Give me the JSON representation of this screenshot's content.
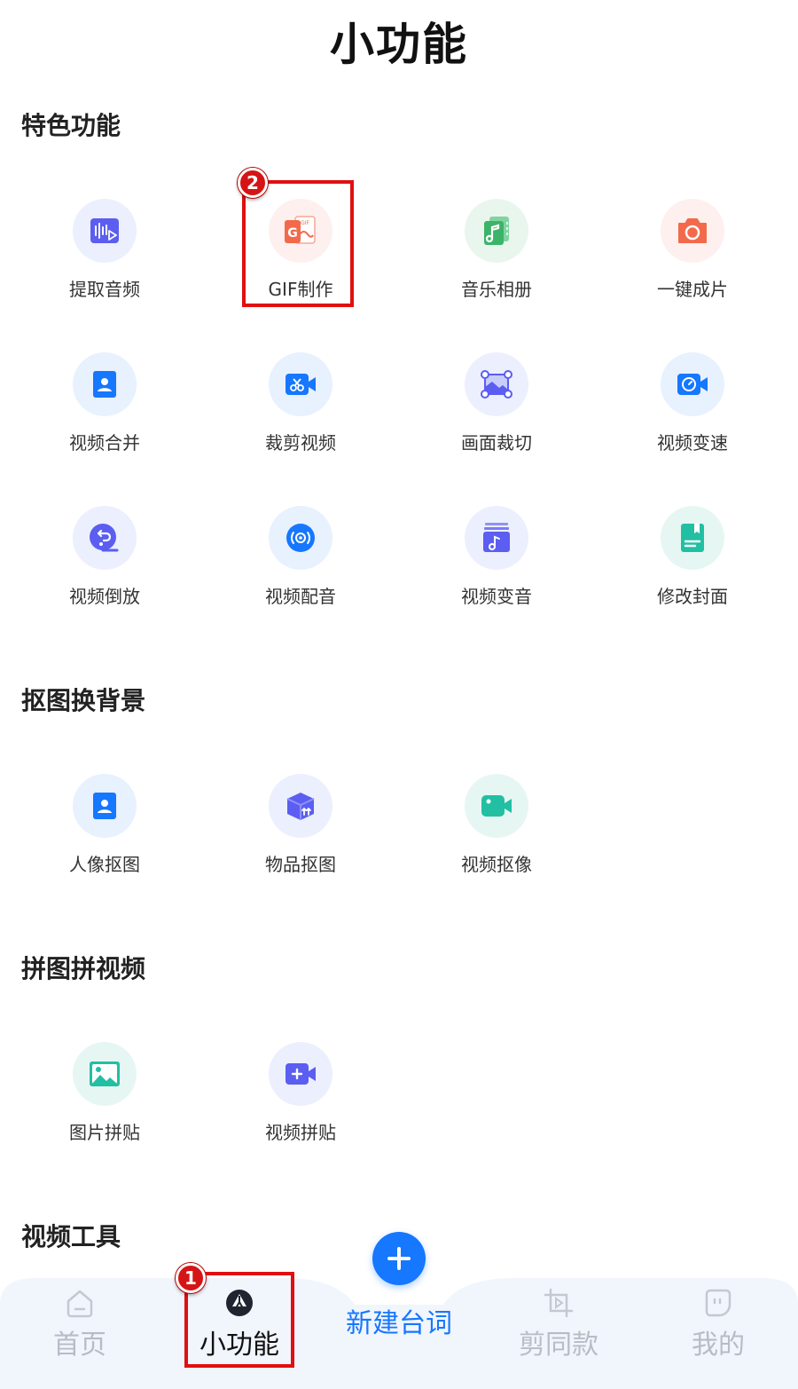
{
  "header": {
    "title": "小功能"
  },
  "sections": {
    "featured": {
      "title": "特色功能",
      "items": [
        {
          "label": "提取音频",
          "icon": "audio-extract-icon",
          "color": "#5b5ef0",
          "bg": "#eceffd"
        },
        {
          "label": "GIF制作",
          "icon": "gif-icon",
          "color": "#f26a4b",
          "bg": "#fdf0ee"
        },
        {
          "label": "音乐相册",
          "icon": "music-album-icon",
          "color": "#3db36a",
          "bg": "#e9f6ee"
        },
        {
          "label": "一键成片",
          "icon": "camera-icon",
          "color": "#f26a4b",
          "bg": "#fdf0ee"
        },
        {
          "label": "视频合并",
          "icon": "video-merge-icon",
          "color": "#1677ff",
          "bg": "#e8f1fe"
        },
        {
          "label": "裁剪视频",
          "icon": "video-trim-icon",
          "color": "#1677ff",
          "bg": "#e8f1fe"
        },
        {
          "label": "画面裁切",
          "icon": "crop-icon",
          "color": "#5b5ef0",
          "bg": "#eceffd"
        },
        {
          "label": "视频变速",
          "icon": "speed-icon",
          "color": "#1677ff",
          "bg": "#e8f1fe"
        },
        {
          "label": "视频倒放",
          "icon": "reverse-icon",
          "color": "#5b5ef0",
          "bg": "#eceffd"
        },
        {
          "label": "视频配音",
          "icon": "dubbing-icon",
          "color": "#1677ff",
          "bg": "#e8f1fe"
        },
        {
          "label": "视频变音",
          "icon": "voice-change-icon",
          "color": "#5b5ef0",
          "bg": "#eceffd"
        },
        {
          "label": "修改封面",
          "icon": "cover-icon",
          "color": "#23bfa3",
          "bg": "#e6f7f3"
        }
      ]
    },
    "cutout": {
      "title": "抠图换背景",
      "items": [
        {
          "label": "人像抠图",
          "icon": "portrait-icon",
          "color": "#1677ff",
          "bg": "#e8f1fe"
        },
        {
          "label": "物品抠图",
          "icon": "object-icon",
          "color": "#5b5ef0",
          "bg": "#eceffd"
        },
        {
          "label": "视频抠像",
          "icon": "video-cutout-icon",
          "color": "#23bfa3",
          "bg": "#e6f7f3"
        }
      ]
    },
    "collage": {
      "title": "拼图拼视频",
      "items": [
        {
          "label": "图片拼贴",
          "icon": "image-collage-icon",
          "color": "#23bfa3",
          "bg": "#e6f7f3"
        },
        {
          "label": "视频拼贴",
          "icon": "video-collage-icon",
          "color": "#5b5ef0",
          "bg": "#eceffd"
        }
      ]
    },
    "tools": {
      "title": "视频工具"
    }
  },
  "annotations": {
    "badge_1": "1",
    "badge_2": "2"
  },
  "tabbar": {
    "home": "首页",
    "features": "小功能",
    "create": "新建台词",
    "template": "剪同款",
    "mine": "我的"
  },
  "colors": {
    "accent": "#1677ff",
    "annotation": "#e01010"
  }
}
